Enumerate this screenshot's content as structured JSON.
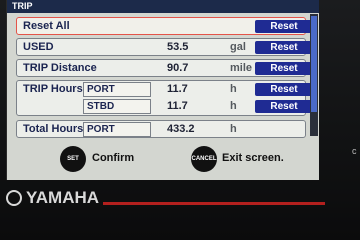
{
  "screen": {
    "title": "TRIP"
  },
  "rows": {
    "reset_all": {
      "label": "Reset All",
      "button": "Reset"
    },
    "used": {
      "label": "USED",
      "value": "53.5",
      "unit": "gal",
      "button": "Reset"
    },
    "trip_distance": {
      "label": "TRIP Distance",
      "value": "90.7",
      "unit": "mile",
      "button": "Reset"
    },
    "trip_hours": {
      "label": "TRIP Hours",
      "port": {
        "label": "PORT",
        "value": "11.7",
        "unit": "h",
        "button": "Reset"
      },
      "stbd": {
        "label": "STBD",
        "value": "11.7",
        "unit": "h",
        "button": "Reset"
      }
    },
    "total_hours": {
      "label": "Total Hours",
      "sub_label": "PORT",
      "value": "433.2",
      "unit": "h"
    }
  },
  "footer": {
    "set_key": "SET",
    "confirm_label": "Confirm",
    "cancel_key": "CANCEL",
    "exit_label": "Exit screen."
  },
  "brand": {
    "name": "YAMAHA"
  },
  "side_text": "c"
}
